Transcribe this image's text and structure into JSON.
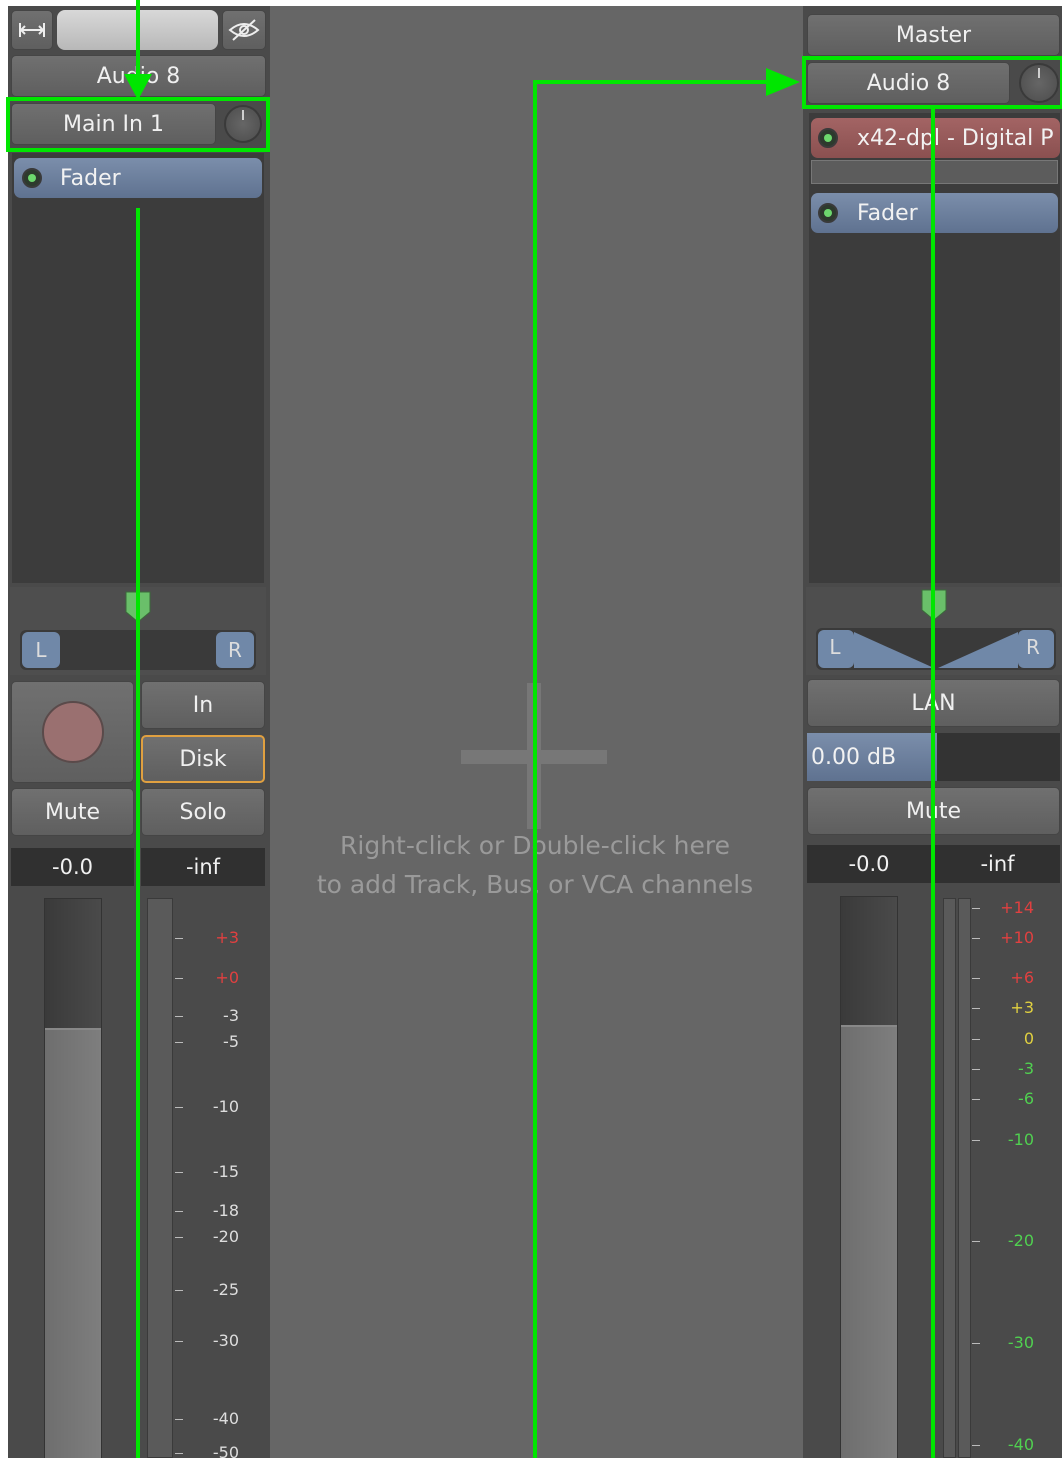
{
  "left_strip": {
    "name_label": "Audio 8",
    "input_label": "Main In 1",
    "processor_label": "Fader",
    "pan_left": "L",
    "pan_right": "R",
    "in_label": "In",
    "disk_label": "Disk",
    "mute_label": "Mute",
    "solo_label": "Solo",
    "gain_readout": "-0.0",
    "peak_readout": "-inf",
    "meter_labels": [
      "+3",
      "+0",
      "-3",
      "-5",
      "-10",
      "-15",
      "-18",
      "-20",
      "-25",
      "-30",
      "-40",
      "-50"
    ]
  },
  "empty_area": {
    "hint_line1": "Right-click or Double-click here",
    "hint_line2": "to add Track, Bus, or VCA channels"
  },
  "master_strip": {
    "name_label": "Master",
    "input_label": "Audio 8",
    "plugin_label": "x42-dpl - Digital P",
    "processor_label": "Fader",
    "pan_left": "L",
    "pan_right": "R",
    "lan_label": "LAN",
    "gain_entry": "0.00 dB",
    "mute_label": "Mute",
    "gain_readout": "-0.0",
    "peak_readout": "-inf",
    "meter_labels": [
      "+14",
      "+10",
      "+6",
      "+3",
      "0",
      "-3",
      "-6",
      "-10",
      "-20",
      "-30",
      "-40"
    ]
  },
  "colors": {
    "highlight": "#00e600",
    "fader_blue": "#6a7fa0",
    "plugin_red": "#9a5a5a",
    "disk_border": "#e0a040",
    "meter_red": "#e04040",
    "meter_yellow": "#e0d040",
    "meter_green": "#50d050"
  }
}
